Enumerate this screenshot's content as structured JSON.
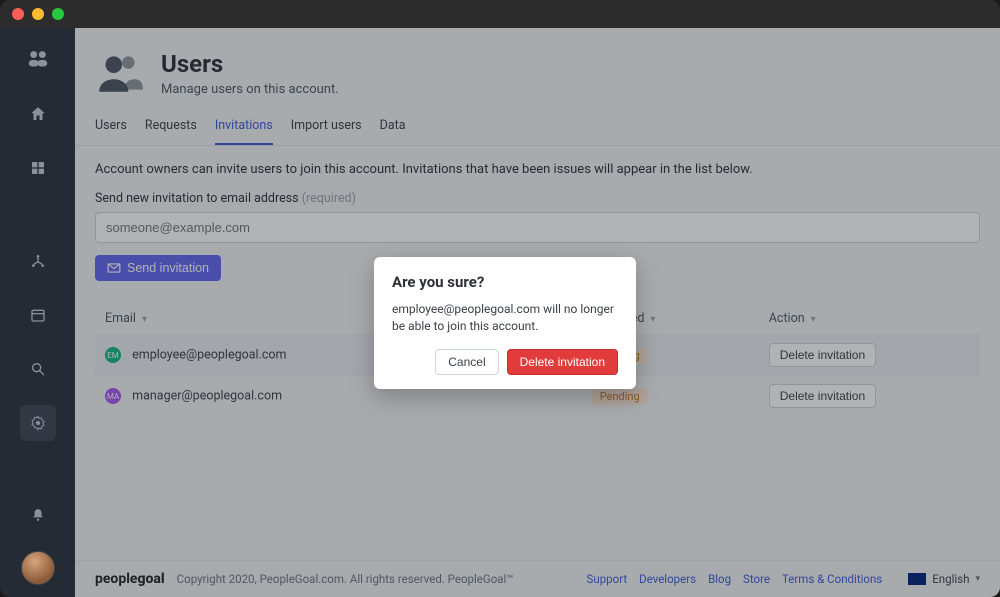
{
  "header": {
    "title": "Users",
    "subtitle": "Manage users on this account."
  },
  "tabs": [
    "Users",
    "Requests",
    "Invitations",
    "Import users",
    "Data"
  ],
  "active_tab": "Invitations",
  "invitations": {
    "description": "Account owners can invite users to join this account. Invitations that have been issues will appear in the list below.",
    "input_label": "Send new invitation to email address",
    "input_required": "(required)",
    "input_placeholder": "someone@example.com",
    "send_button": "Send invitation",
    "columns": {
      "email": "Email",
      "accepted": "Accepted",
      "action": "Action"
    },
    "rows": [
      {
        "initials": "EM",
        "dot": "green",
        "email": "employee@peoplegoal.com",
        "status": "Pending",
        "action": "Delete invitation"
      },
      {
        "initials": "MA",
        "dot": "purple",
        "email": "manager@peoplegoal.com",
        "status": "Pending",
        "action": "Delete invitation"
      }
    ]
  },
  "modal": {
    "title": "Are you sure?",
    "body": "employee@peoplegoal.com will no longer be able to join this account.",
    "cancel": "Cancel",
    "confirm": "Delete invitation"
  },
  "footer": {
    "brand_prefix": "people",
    "brand_suffix": "goal",
    "copyright": "Copyright 2020, PeopleGoal.com. All rights reserved. PeopleGoal™",
    "links": [
      "Support",
      "Developers",
      "Blog",
      "Store",
      "Terms & Conditions"
    ],
    "language": "English"
  }
}
